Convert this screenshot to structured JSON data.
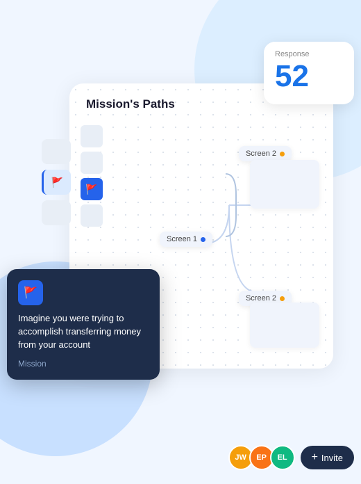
{
  "app": {
    "title": "Mission's Paths"
  },
  "response_card": {
    "label": "Response",
    "number": "52"
  },
  "paths_card": {
    "title": "Mission's Paths",
    "screen1": "Screen 1",
    "screen2_top": "Screen 2",
    "screen2_bottom": "Screen 2"
  },
  "tooltip": {
    "text": "Imagine you were trying to accomplish transferring money from your account",
    "label": "Mission",
    "flag_icon": "🚩"
  },
  "bottom_bar": {
    "avatars": [
      {
        "initials": "JW",
        "color_class": "jw"
      },
      {
        "initials": "EP",
        "color_class": "ep"
      },
      {
        "initials": "EL",
        "color_class": "el"
      }
    ],
    "invite_label": "+ Invite"
  },
  "sidebar": {
    "items": [
      {
        "label": ""
      },
      {
        "label": ""
      },
      {
        "label": "flag",
        "active": true
      }
    ]
  }
}
